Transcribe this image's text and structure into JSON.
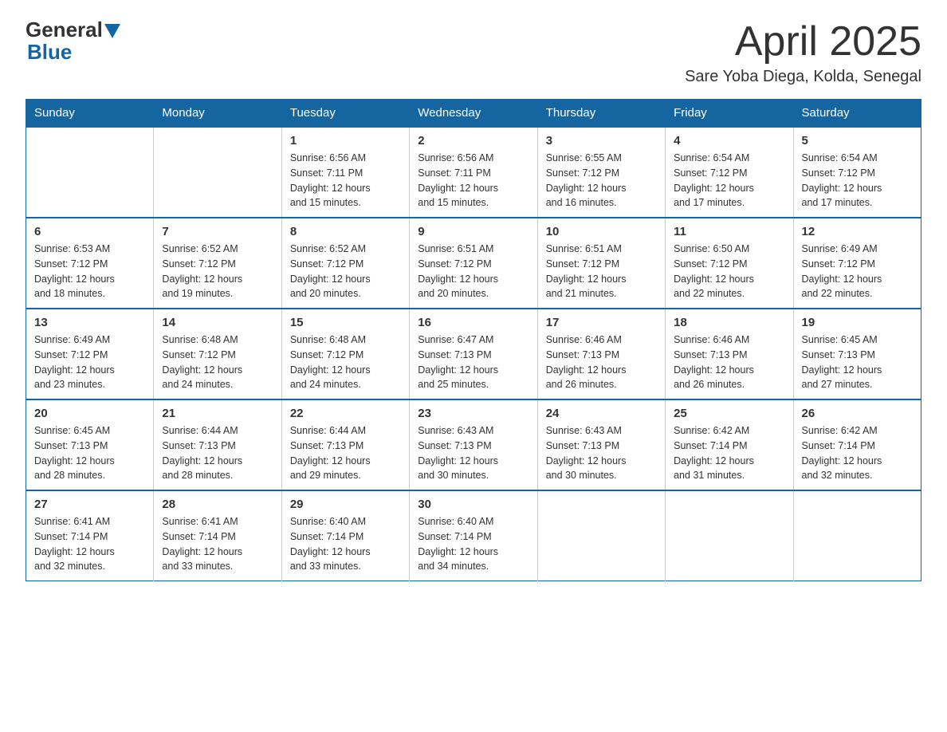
{
  "logo": {
    "general": "General",
    "blue": "Blue"
  },
  "title": "April 2025",
  "subtitle": "Sare Yoba Diega, Kolda, Senegal",
  "header_days": [
    "Sunday",
    "Monday",
    "Tuesday",
    "Wednesday",
    "Thursday",
    "Friday",
    "Saturday"
  ],
  "weeks": [
    [
      {
        "day": "",
        "info": ""
      },
      {
        "day": "",
        "info": ""
      },
      {
        "day": "1",
        "info": "Sunrise: 6:56 AM\nSunset: 7:11 PM\nDaylight: 12 hours\nand 15 minutes."
      },
      {
        "day": "2",
        "info": "Sunrise: 6:56 AM\nSunset: 7:11 PM\nDaylight: 12 hours\nand 15 minutes."
      },
      {
        "day": "3",
        "info": "Sunrise: 6:55 AM\nSunset: 7:12 PM\nDaylight: 12 hours\nand 16 minutes."
      },
      {
        "day": "4",
        "info": "Sunrise: 6:54 AM\nSunset: 7:12 PM\nDaylight: 12 hours\nand 17 minutes."
      },
      {
        "day": "5",
        "info": "Sunrise: 6:54 AM\nSunset: 7:12 PM\nDaylight: 12 hours\nand 17 minutes."
      }
    ],
    [
      {
        "day": "6",
        "info": "Sunrise: 6:53 AM\nSunset: 7:12 PM\nDaylight: 12 hours\nand 18 minutes."
      },
      {
        "day": "7",
        "info": "Sunrise: 6:52 AM\nSunset: 7:12 PM\nDaylight: 12 hours\nand 19 minutes."
      },
      {
        "day": "8",
        "info": "Sunrise: 6:52 AM\nSunset: 7:12 PM\nDaylight: 12 hours\nand 20 minutes."
      },
      {
        "day": "9",
        "info": "Sunrise: 6:51 AM\nSunset: 7:12 PM\nDaylight: 12 hours\nand 20 minutes."
      },
      {
        "day": "10",
        "info": "Sunrise: 6:51 AM\nSunset: 7:12 PM\nDaylight: 12 hours\nand 21 minutes."
      },
      {
        "day": "11",
        "info": "Sunrise: 6:50 AM\nSunset: 7:12 PM\nDaylight: 12 hours\nand 22 minutes."
      },
      {
        "day": "12",
        "info": "Sunrise: 6:49 AM\nSunset: 7:12 PM\nDaylight: 12 hours\nand 22 minutes."
      }
    ],
    [
      {
        "day": "13",
        "info": "Sunrise: 6:49 AM\nSunset: 7:12 PM\nDaylight: 12 hours\nand 23 minutes."
      },
      {
        "day": "14",
        "info": "Sunrise: 6:48 AM\nSunset: 7:12 PM\nDaylight: 12 hours\nand 24 minutes."
      },
      {
        "day": "15",
        "info": "Sunrise: 6:48 AM\nSunset: 7:12 PM\nDaylight: 12 hours\nand 24 minutes."
      },
      {
        "day": "16",
        "info": "Sunrise: 6:47 AM\nSunset: 7:13 PM\nDaylight: 12 hours\nand 25 minutes."
      },
      {
        "day": "17",
        "info": "Sunrise: 6:46 AM\nSunset: 7:13 PM\nDaylight: 12 hours\nand 26 minutes."
      },
      {
        "day": "18",
        "info": "Sunrise: 6:46 AM\nSunset: 7:13 PM\nDaylight: 12 hours\nand 26 minutes."
      },
      {
        "day": "19",
        "info": "Sunrise: 6:45 AM\nSunset: 7:13 PM\nDaylight: 12 hours\nand 27 minutes."
      }
    ],
    [
      {
        "day": "20",
        "info": "Sunrise: 6:45 AM\nSunset: 7:13 PM\nDaylight: 12 hours\nand 28 minutes."
      },
      {
        "day": "21",
        "info": "Sunrise: 6:44 AM\nSunset: 7:13 PM\nDaylight: 12 hours\nand 28 minutes."
      },
      {
        "day": "22",
        "info": "Sunrise: 6:44 AM\nSunset: 7:13 PM\nDaylight: 12 hours\nand 29 minutes."
      },
      {
        "day": "23",
        "info": "Sunrise: 6:43 AM\nSunset: 7:13 PM\nDaylight: 12 hours\nand 30 minutes."
      },
      {
        "day": "24",
        "info": "Sunrise: 6:43 AM\nSunset: 7:13 PM\nDaylight: 12 hours\nand 30 minutes."
      },
      {
        "day": "25",
        "info": "Sunrise: 6:42 AM\nSunset: 7:14 PM\nDaylight: 12 hours\nand 31 minutes."
      },
      {
        "day": "26",
        "info": "Sunrise: 6:42 AM\nSunset: 7:14 PM\nDaylight: 12 hours\nand 32 minutes."
      }
    ],
    [
      {
        "day": "27",
        "info": "Sunrise: 6:41 AM\nSunset: 7:14 PM\nDaylight: 12 hours\nand 32 minutes."
      },
      {
        "day": "28",
        "info": "Sunrise: 6:41 AM\nSunset: 7:14 PM\nDaylight: 12 hours\nand 33 minutes."
      },
      {
        "day": "29",
        "info": "Sunrise: 6:40 AM\nSunset: 7:14 PM\nDaylight: 12 hours\nand 33 minutes."
      },
      {
        "day": "30",
        "info": "Sunrise: 6:40 AM\nSunset: 7:14 PM\nDaylight: 12 hours\nand 34 minutes."
      },
      {
        "day": "",
        "info": ""
      },
      {
        "day": "",
        "info": ""
      },
      {
        "day": "",
        "info": ""
      }
    ]
  ]
}
